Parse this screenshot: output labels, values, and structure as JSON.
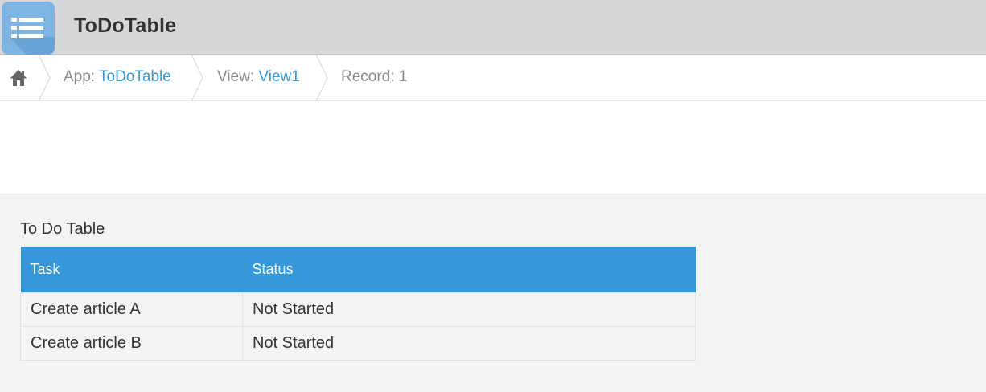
{
  "header": {
    "app_title": "ToDoTable",
    "app_icon": "list-table-icon",
    "colors": {
      "bar": "#d6d7d6",
      "icon_bg": "#7fb5e3"
    }
  },
  "breadcrumb": {
    "home_icon": "home-icon",
    "app_prefix": "App: ",
    "app_name": "ToDoTable",
    "view_prefix": "View: ",
    "view_name": "View1",
    "record_label": "Record: 1",
    "colors": {
      "text": "#8a8a8a",
      "link": "#3498db"
    }
  },
  "record": {
    "table_title": "To Do Table",
    "columns": [
      "Task",
      "Status"
    ],
    "rows": [
      {
        "task": "Create article A",
        "status": "Not Started"
      },
      {
        "task": "Create article B",
        "status": "Not Started"
      }
    ],
    "colors": {
      "header_bg": "#3498db",
      "area_bg": "#f4f4f4"
    }
  }
}
